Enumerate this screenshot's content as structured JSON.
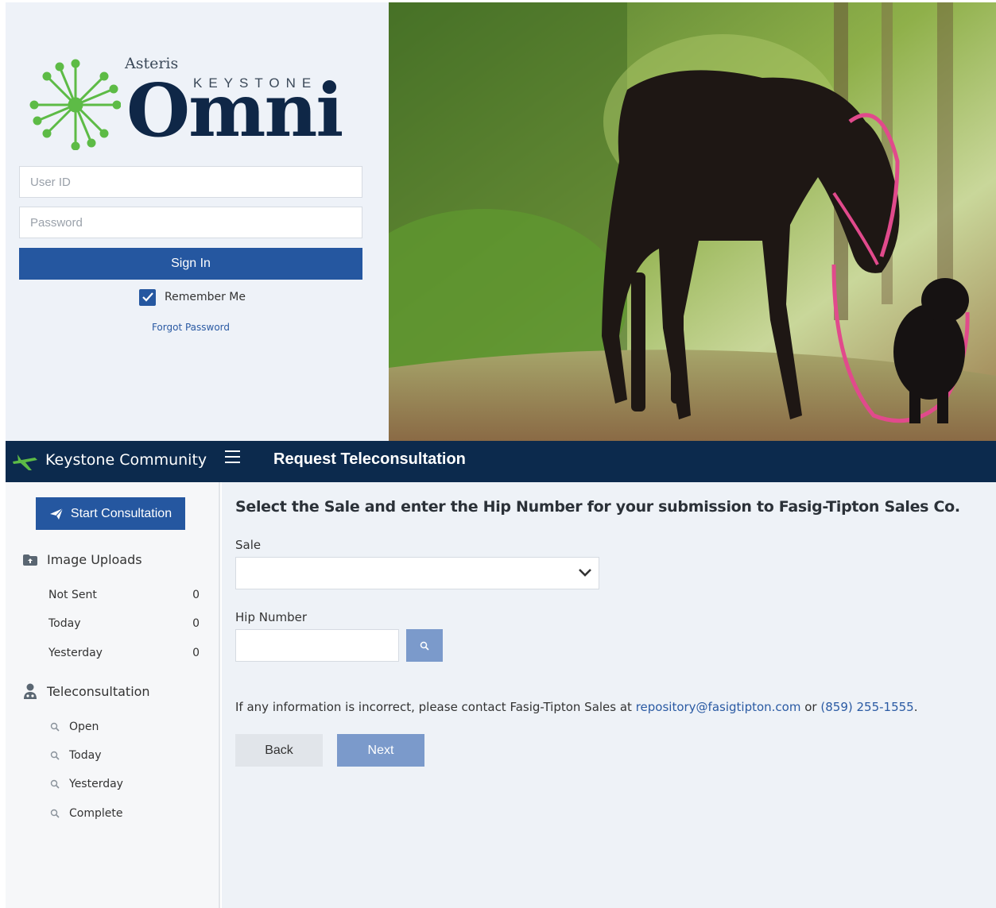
{
  "login": {
    "logo_brand": "Asteris",
    "logo_sub": "KEYSTONE",
    "logo_word": "Omni",
    "userid_placeholder": "User ID",
    "password_placeholder": "Password",
    "signin_label": "Sign In",
    "remember_label": "Remember Me",
    "remember_checked": true,
    "forgot_label": "Forgot Password"
  },
  "header": {
    "brand_name": "Keystone Community",
    "page_title": "Request Teleconsultation"
  },
  "sidebar": {
    "start_label": "Start Consultation",
    "uploads_title": "Image Uploads",
    "uploads": [
      {
        "label": "Not Sent",
        "count": "0"
      },
      {
        "label": "Today",
        "count": "0"
      },
      {
        "label": "Yesterday",
        "count": "0"
      }
    ],
    "tele_title": "Teleconsultation",
    "tele_items": [
      {
        "label": "Open"
      },
      {
        "label": "Today"
      },
      {
        "label": "Yesterday"
      },
      {
        "label": "Complete"
      }
    ]
  },
  "main": {
    "instruction": "Select the Sale and enter the Hip Number for your submission to Fasig-Tipton Sales Co.",
    "sale_label": "Sale",
    "sale_value": "",
    "hip_label": "Hip Number",
    "hip_value": "",
    "contact_prefix": "If any information is incorrect, please contact Fasig-Tipton Sales at ",
    "contact_email": "repository@fasigtipton.com",
    "contact_middle": " or ",
    "contact_phone": "(859) 255-1555",
    "contact_suffix": ".",
    "back_label": "Back",
    "next_label": "Next"
  },
  "colors": {
    "header_bg": "#0c2a4d",
    "primary": "#2557a0",
    "disabled_primary": "#7b9acb",
    "logo_green": "#5dbb46",
    "link": "#2a5aa3"
  },
  "icons": {
    "logo": "asterisk-network-icon",
    "brand": "plane-cross-icon",
    "menu": "hamburger-icon",
    "start": "paper-plane-icon",
    "uploads": "folder-upload-icon",
    "tele": "doctor-icon",
    "query": "search-icon",
    "sale_select": "chevron-down-icon",
    "hip_search": "search-icon"
  }
}
